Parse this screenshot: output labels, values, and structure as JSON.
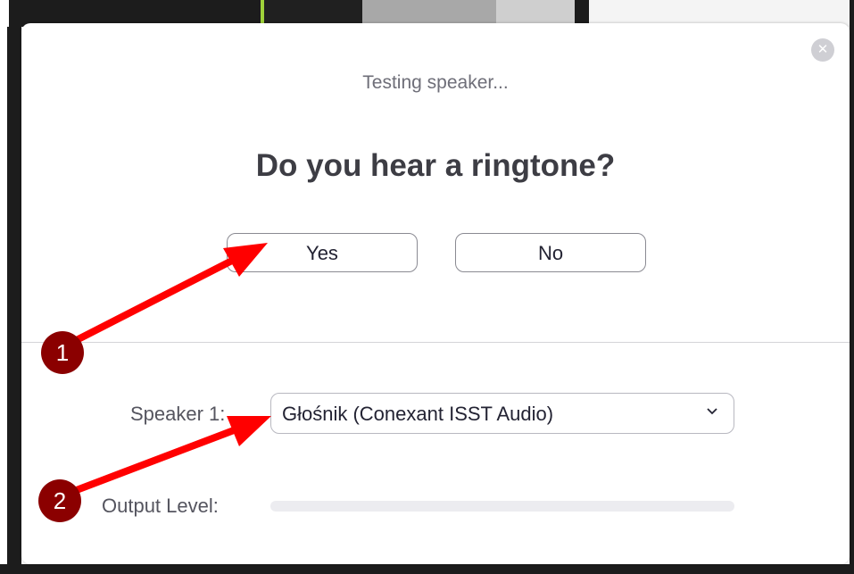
{
  "dialog": {
    "status_text": "Testing speaker...",
    "question": "Do you hear a ringtone?",
    "yes_label": "Yes",
    "no_label": "No",
    "close_icon": "close-icon",
    "speaker_label": "Speaker 1:",
    "speaker_value": "Głośnik (Conexant ISST Audio)",
    "output_label": "Output Level:",
    "output_level": 0
  },
  "annotations": [
    {
      "number": "1",
      "color": "#8b0000"
    },
    {
      "number": "2",
      "color": "#8b0000"
    }
  ],
  "colors": {
    "arrow": "#ff0000",
    "accent": "#2d8cff"
  }
}
